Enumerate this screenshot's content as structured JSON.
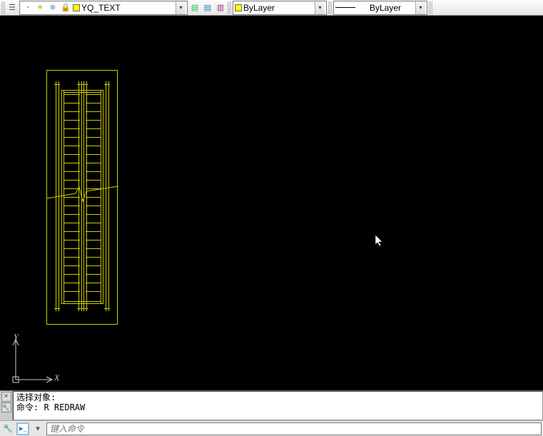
{
  "toolbar": {
    "layer_dropdown": {
      "layer_name": "YQ_TEXT",
      "swatch_color": "#ffff00"
    },
    "color_dropdown": {
      "label": "ByLayer",
      "swatch_color": "#ffff00"
    },
    "linetype_dropdown": {
      "label": "ByLayer"
    }
  },
  "icons": {
    "layers_tree": "☰",
    "bulb": "◔",
    "sun": "☀",
    "freeze": "❄",
    "lock": "🔒",
    "sheet1": "▤",
    "sheet2": "▤",
    "sheet3": "▥",
    "chevron_down": "▾",
    "wrench": "🔧",
    "terminal": "▶_",
    "history": "▾"
  },
  "ucs": {
    "x_label": "X",
    "y_label": "Y"
  },
  "command_log": {
    "line1": "选择对象:",
    "line2": "命令: R REDRAW"
  },
  "command_input": {
    "placeholder": "键入命令"
  },
  "colors": {
    "drawing_yellow": "#cccc00"
  }
}
